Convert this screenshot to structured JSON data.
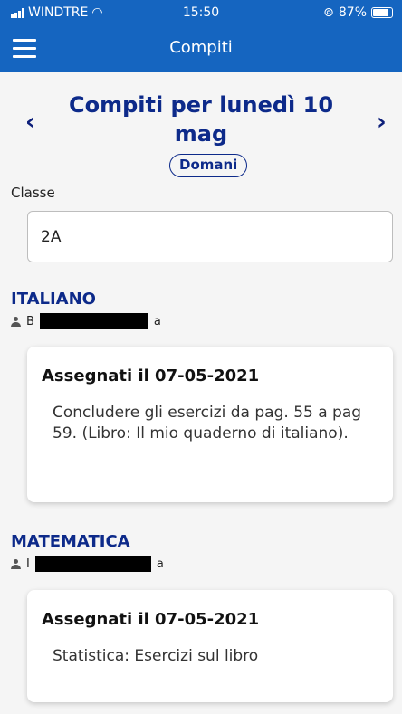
{
  "status_bar": {
    "carrier": "WINDTRE",
    "time": "15:50",
    "battery": "87%",
    "battery_level": 0.87
  },
  "app_bar": {
    "title": "Compiti",
    "menu_icon": "hamburger-menu-icon"
  },
  "page": {
    "heading": "Compiti per lunedì 10 mag",
    "day_badge": "Domani",
    "prev_icon": "chevron-left-icon",
    "next_icon": "chevron-right-icon"
  },
  "class_selector": {
    "label": "Classe",
    "value": "2A"
  },
  "subjects": [
    {
      "name": "ITALIANO",
      "teacher_first": "B",
      "teacher_last": "a",
      "assigned": "Assegnati il 07-05-2021",
      "text": "Concludere gli esercizi da pag. 55 a pag 59. (Libro: Il mio quaderno di italiano)."
    },
    {
      "name": "MATEMATICA",
      "teacher_first": "I",
      "teacher_last": "a",
      "assigned": "Assegnati il 07-05-2021",
      "text": "Statistica: Esercizi sul libro"
    }
  ],
  "colors": {
    "app_bar": "#1565c0",
    "heading": "#0d2a8a",
    "background": "#f5f5f5"
  }
}
